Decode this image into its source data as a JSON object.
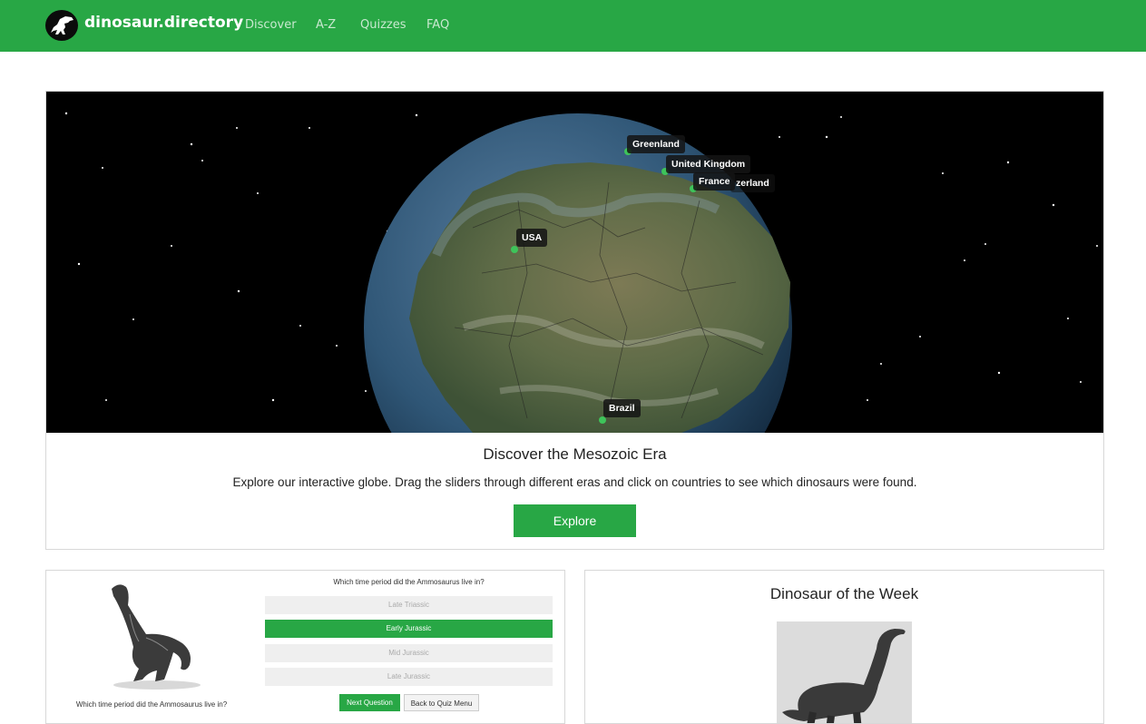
{
  "brand": {
    "name": "dinosaur.directory"
  },
  "nav": {
    "items": [
      {
        "label": "Discover"
      },
      {
        "label": "A-Z"
      },
      {
        "label": "Quizzes"
      },
      {
        "label": "FAQ"
      }
    ]
  },
  "hero": {
    "title": "Discover the Mesozoic Era",
    "description": "Explore our interactive globe. Drag the sliders through different eras and click on countries to see which dinosaurs were found.",
    "button_label": "Explore",
    "countries": [
      "Greenland",
      "United Kingdom",
      "France",
      "zerland",
      "USA",
      "Brazil"
    ]
  },
  "quiz": {
    "caption": "Which time period did the Ammosaurus live in?",
    "question": "Which time period did the Ammosaurus live in?",
    "options": [
      "Late Triassic",
      "Early Jurassic",
      "Mid Jurassic",
      "Late Jurassic"
    ],
    "selected_option": "Early Jurassic",
    "next_label": "Next Question",
    "back_label": "Back to Quiz Menu"
  },
  "dinosaur_of_week": {
    "title": "Dinosaur of the Week"
  },
  "colors": {
    "brand_green": "#28a745",
    "background": "#ffffff",
    "space": "#000000"
  }
}
